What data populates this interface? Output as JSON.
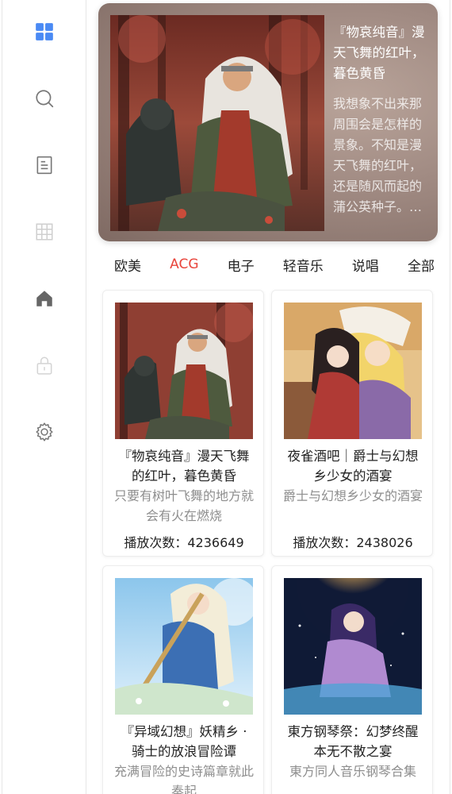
{
  "sidebar": {
    "items": [
      {
        "name": "grid",
        "icon": "grid-icon",
        "active": true
      },
      {
        "name": "search",
        "icon": "search-icon"
      },
      {
        "name": "document",
        "icon": "document-icon"
      },
      {
        "name": "table",
        "icon": "table-icon"
      },
      {
        "name": "home",
        "icon": "home-icon"
      },
      {
        "name": "lock",
        "icon": "lock-icon"
      },
      {
        "name": "settings",
        "icon": "gear-icon"
      }
    ],
    "active_color": "#4a8af4"
  },
  "hero": {
    "title": "『物哀纯音』漫天飞舞的红叶，暮色黄昏",
    "description": "我想象不出来那周围会是怎样的景象。不知是漫天飞舞的红叶，还是随风而起的蒲公英种子。…"
  },
  "tabs": [
    {
      "label": "欧美"
    },
    {
      "label": "ACG",
      "active": true
    },
    {
      "label": "电子"
    },
    {
      "label": "轻音乐"
    },
    {
      "label": "说唱"
    },
    {
      "label": "全部"
    }
  ],
  "accent_color": "#e8453c",
  "plays_label": "播放次数：",
  "playlists": [
    {
      "title": "『物哀纯音』漫天飞舞的红叶，暮色黄昏",
      "description": "只要有树叶飞舞的地方就会有火在燃烧",
      "plays": "4236649"
    },
    {
      "title": "夜雀酒吧｜爵士与幻想乡少女的酒宴",
      "description": "爵士与幻想乡少女的酒宴",
      "plays": "2438026"
    },
    {
      "title": "『异域幻想』妖精乡 · 骑士的放浪冒险谭",
      "description": "充满冒险的史诗篇章就此奏起",
      "plays": ""
    },
    {
      "title": "東方钢琴祭：幻梦终醒 本无不散之宴",
      "description": "東方同人音乐钢琴合集",
      "plays": ""
    }
  ]
}
